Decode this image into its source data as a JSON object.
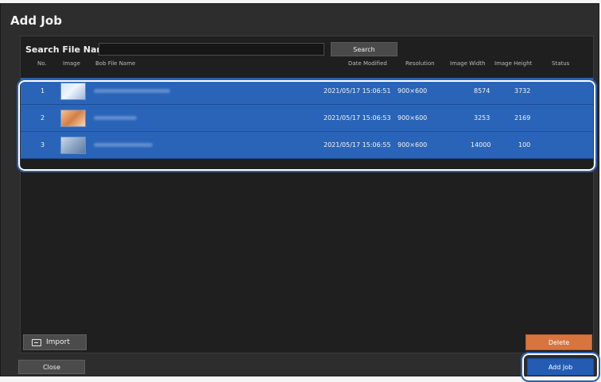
{
  "dialog": {
    "title": "Add Job"
  },
  "search": {
    "label": "Search File Name",
    "value": "",
    "placeholder": "",
    "button_label": "Search"
  },
  "table": {
    "headers": [
      "No.",
      "Image",
      "Bob File Name",
      "Date Modified",
      "Resolution",
      "Image Width",
      "Image Height",
      "Status"
    ],
    "rows": [
      {
        "no": "1",
        "date_modified": "2021/05/17 15:06:51",
        "resolution": "900×600",
        "image_width": "8574",
        "image_height": "3732",
        "status": ""
      },
      {
        "no": "2",
        "date_modified": "2021/05/17 15:06:53",
        "resolution": "900×600",
        "image_width": "3253",
        "image_height": "2169",
        "status": ""
      },
      {
        "no": "3",
        "date_modified": "2021/05/17 15:06:55",
        "resolution": "900×600",
        "image_width": "14000",
        "image_height": "100",
        "status": ""
      }
    ]
  },
  "actions": {
    "import_label": "Import",
    "delete_label": "Delete",
    "close_label": "Close",
    "add_job_label": "Add Job"
  },
  "colors": {
    "selected_row": "#2a64b8",
    "delete": "#d8743f",
    "add_job": "#245bb3",
    "dialog_bg": "#2d2d2d"
  }
}
